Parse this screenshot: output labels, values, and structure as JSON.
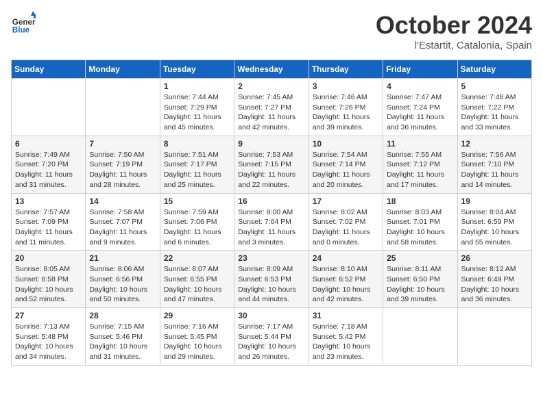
{
  "header": {
    "logo": {
      "general": "General",
      "blue": "Blue"
    },
    "title": "October 2024",
    "location": "l'Estartit, Catalonia, Spain"
  },
  "calendar": {
    "headers": [
      "Sunday",
      "Monday",
      "Tuesday",
      "Wednesday",
      "Thursday",
      "Friday",
      "Saturday"
    ],
    "rows": [
      [
        {
          "day": "",
          "info": ""
        },
        {
          "day": "",
          "info": ""
        },
        {
          "day": "1",
          "info": "Sunrise: 7:44 AM\nSunset: 7:29 PM\nDaylight: 11 hours and 45 minutes."
        },
        {
          "day": "2",
          "info": "Sunrise: 7:45 AM\nSunset: 7:27 PM\nDaylight: 11 hours and 42 minutes."
        },
        {
          "day": "3",
          "info": "Sunrise: 7:46 AM\nSunset: 7:26 PM\nDaylight: 11 hours and 39 minutes."
        },
        {
          "day": "4",
          "info": "Sunrise: 7:47 AM\nSunset: 7:24 PM\nDaylight: 11 hours and 36 minutes."
        },
        {
          "day": "5",
          "info": "Sunrise: 7:48 AM\nSunset: 7:22 PM\nDaylight: 11 hours and 33 minutes."
        }
      ],
      [
        {
          "day": "6",
          "info": "Sunrise: 7:49 AM\nSunset: 7:20 PM\nDaylight: 11 hours and 31 minutes."
        },
        {
          "day": "7",
          "info": "Sunrise: 7:50 AM\nSunset: 7:19 PM\nDaylight: 11 hours and 28 minutes."
        },
        {
          "day": "8",
          "info": "Sunrise: 7:51 AM\nSunset: 7:17 PM\nDaylight: 11 hours and 25 minutes."
        },
        {
          "day": "9",
          "info": "Sunrise: 7:53 AM\nSunset: 7:15 PM\nDaylight: 11 hours and 22 minutes."
        },
        {
          "day": "10",
          "info": "Sunrise: 7:54 AM\nSunset: 7:14 PM\nDaylight: 11 hours and 20 minutes."
        },
        {
          "day": "11",
          "info": "Sunrise: 7:55 AM\nSunset: 7:12 PM\nDaylight: 11 hours and 17 minutes."
        },
        {
          "day": "12",
          "info": "Sunrise: 7:56 AM\nSunset: 7:10 PM\nDaylight: 11 hours and 14 minutes."
        }
      ],
      [
        {
          "day": "13",
          "info": "Sunrise: 7:57 AM\nSunset: 7:09 PM\nDaylight: 11 hours and 11 minutes."
        },
        {
          "day": "14",
          "info": "Sunrise: 7:58 AM\nSunset: 7:07 PM\nDaylight: 11 hours and 9 minutes."
        },
        {
          "day": "15",
          "info": "Sunrise: 7:59 AM\nSunset: 7:06 PM\nDaylight: 11 hours and 6 minutes."
        },
        {
          "day": "16",
          "info": "Sunrise: 8:00 AM\nSunset: 7:04 PM\nDaylight: 11 hours and 3 minutes."
        },
        {
          "day": "17",
          "info": "Sunrise: 8:02 AM\nSunset: 7:02 PM\nDaylight: 11 hours and 0 minutes."
        },
        {
          "day": "18",
          "info": "Sunrise: 8:03 AM\nSunset: 7:01 PM\nDaylight: 10 hours and 58 minutes."
        },
        {
          "day": "19",
          "info": "Sunrise: 8:04 AM\nSunset: 6:59 PM\nDaylight: 10 hours and 55 minutes."
        }
      ],
      [
        {
          "day": "20",
          "info": "Sunrise: 8:05 AM\nSunset: 6:58 PM\nDaylight: 10 hours and 52 minutes."
        },
        {
          "day": "21",
          "info": "Sunrise: 8:06 AM\nSunset: 6:56 PM\nDaylight: 10 hours and 50 minutes."
        },
        {
          "day": "22",
          "info": "Sunrise: 8:07 AM\nSunset: 6:55 PM\nDaylight: 10 hours and 47 minutes."
        },
        {
          "day": "23",
          "info": "Sunrise: 8:09 AM\nSunset: 6:53 PM\nDaylight: 10 hours and 44 minutes."
        },
        {
          "day": "24",
          "info": "Sunrise: 8:10 AM\nSunset: 6:52 PM\nDaylight: 10 hours and 42 minutes."
        },
        {
          "day": "25",
          "info": "Sunrise: 8:11 AM\nSunset: 6:50 PM\nDaylight: 10 hours and 39 minutes."
        },
        {
          "day": "26",
          "info": "Sunrise: 8:12 AM\nSunset: 6:49 PM\nDaylight: 10 hours and 36 minutes."
        }
      ],
      [
        {
          "day": "27",
          "info": "Sunrise: 7:13 AM\nSunset: 5:48 PM\nDaylight: 10 hours and 34 minutes."
        },
        {
          "day": "28",
          "info": "Sunrise: 7:15 AM\nSunset: 5:46 PM\nDaylight: 10 hours and 31 minutes."
        },
        {
          "day": "29",
          "info": "Sunrise: 7:16 AM\nSunset: 5:45 PM\nDaylight: 10 hours and 29 minutes."
        },
        {
          "day": "30",
          "info": "Sunrise: 7:17 AM\nSunset: 5:44 PM\nDaylight: 10 hours and 26 minutes."
        },
        {
          "day": "31",
          "info": "Sunrise: 7:18 AM\nSunset: 5:42 PM\nDaylight: 10 hours and 23 minutes."
        },
        {
          "day": "",
          "info": ""
        },
        {
          "day": "",
          "info": ""
        }
      ]
    ]
  }
}
